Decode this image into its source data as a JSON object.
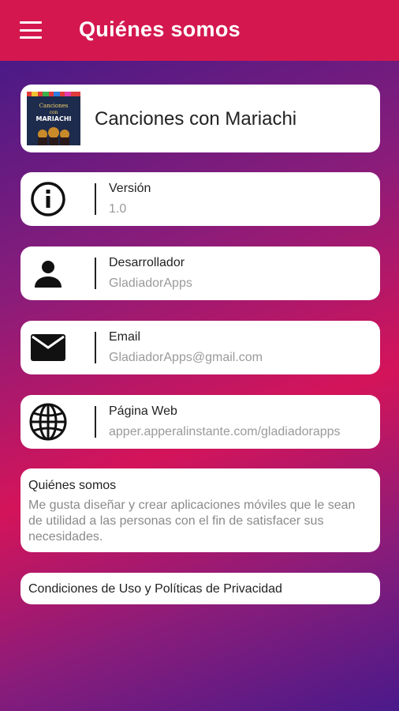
{
  "appbar": {
    "title": "Quiénes somos",
    "menu_icon": "menu-icon"
  },
  "app": {
    "name": "Canciones con Mariachi",
    "thumb_text": "Canciones",
    "thumb_subtext": "con",
    "thumb_title": "MARIACHI"
  },
  "info": [
    {
      "icon": "info-icon",
      "label": "Versión",
      "value": "1.0"
    },
    {
      "icon": "person-icon",
      "label": "Desarrollador",
      "value": "GladiadorApps"
    },
    {
      "icon": "mail-icon",
      "label": "Email",
      "value": "GladiadorApps@gmail.com"
    },
    {
      "icon": "globe-icon",
      "label": "Página Web",
      "value": "apper.apperalinstante.com/gladiadorapps"
    }
  ],
  "about": {
    "title": "Quiénes somos",
    "text": "Me gusta diseñar y crear aplicaciones móviles que le sean de utilidad a las personas con el fin de satisfacer sus necesidades."
  },
  "terms": {
    "label": "Condiciones de Uso y Políticas de Privacidad"
  },
  "colors": {
    "appbar": "#d4184f",
    "card": "#ffffff"
  }
}
